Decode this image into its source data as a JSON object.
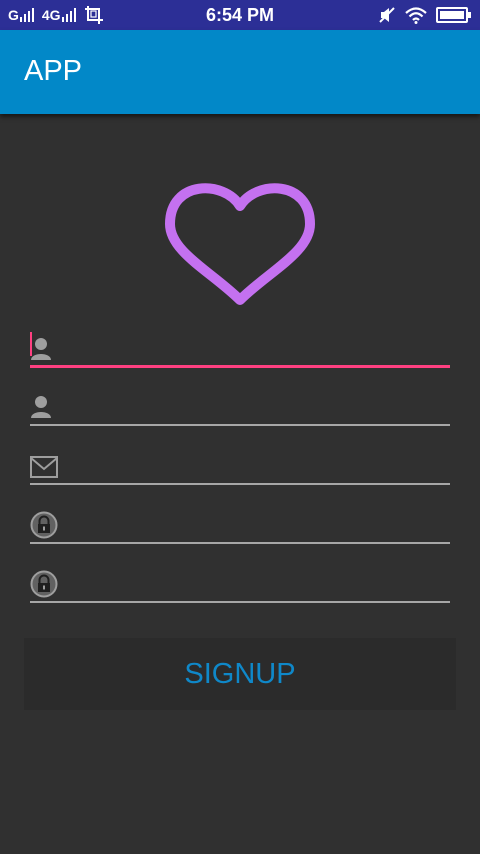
{
  "status_bar": {
    "carrier_1": "G",
    "carrier_2": "4G",
    "time": "6:54 PM",
    "battery_level": 1.0,
    "icons": [
      "signal-icon",
      "screenshot-icon",
      "mute-icon",
      "wifi-icon",
      "battery-icon"
    ]
  },
  "app_bar": {
    "title": "APP"
  },
  "logo": {
    "icon": "heart-icon",
    "color": "#c471f0"
  },
  "form": {
    "fields": [
      {
        "icon": "person-icon",
        "value": "",
        "focused": true
      },
      {
        "icon": "person-icon",
        "value": ""
      },
      {
        "icon": "mail-icon",
        "value": ""
      },
      {
        "icon": "lock-icon",
        "value": ""
      },
      {
        "icon": "lock-icon",
        "value": ""
      }
    ],
    "signup_label": "SIGNUP"
  },
  "colors": {
    "app_bar": "#0288c8",
    "status_bar": "#2c2f96",
    "background": "#303030",
    "accent": "#ff4081",
    "button_text": "#0f88c9"
  }
}
